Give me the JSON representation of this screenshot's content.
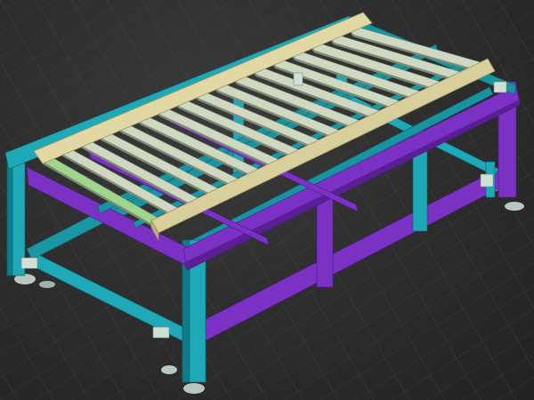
{
  "viewport": {
    "label": "",
    "colors": {
      "background": "#2b2b2b",
      "grid": "#4a4a4a",
      "frame_teal": "#1fa9b8",
      "frame_teal_dark": "#0e7c88",
      "frame_purple": "#7b32c4",
      "frame_purple_dark": "#5a1f96",
      "side_rail": "#d8cf9d",
      "roller": "#cfd8c0",
      "roller_green": "#9fd78a",
      "foot": "#b9c8bf"
    }
  },
  "scene": {
    "object": "roller-conveyor-frame",
    "roller_count": 17,
    "highlighted_roller_index": 0
  }
}
